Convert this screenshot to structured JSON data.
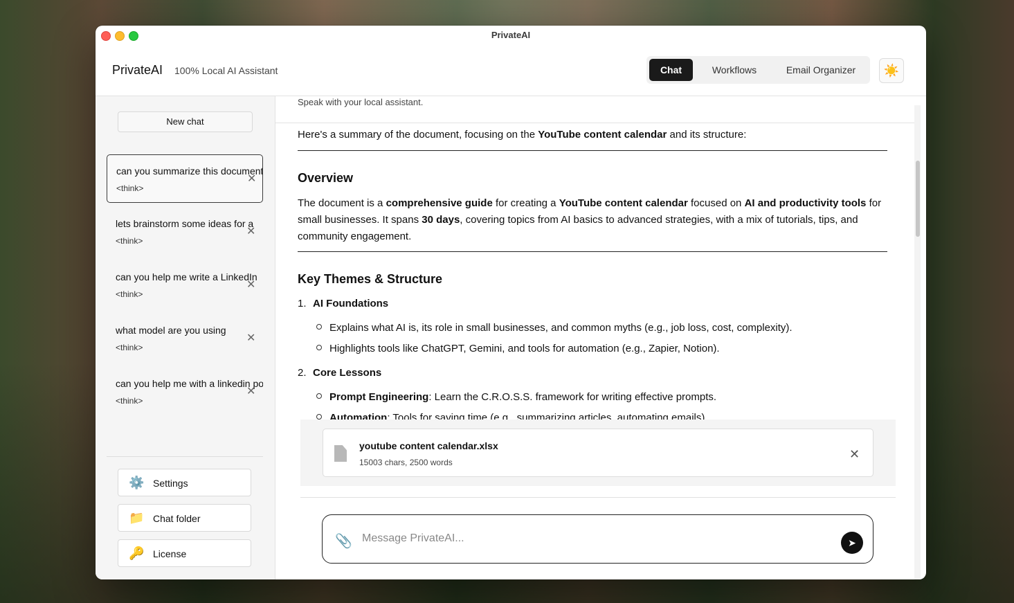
{
  "window": {
    "title": "PrivateAI"
  },
  "header": {
    "brand": "PrivateAI",
    "tagline": "100% Local AI Assistant",
    "tabs": [
      {
        "label": "Chat",
        "active": true
      },
      {
        "label": "Workflows",
        "active": false
      },
      {
        "label": "Email Organizer",
        "active": false
      }
    ],
    "theme_icon": "☀️"
  },
  "sidebar": {
    "new_chat_label": "New chat",
    "chats": [
      {
        "title": "can you summarize this document",
        "preview": "<think>",
        "active": true
      },
      {
        "title": "lets brainstorm some ideas for a",
        "preview": "<think>",
        "active": false
      },
      {
        "title": "can you help me write a LinkedIn",
        "preview": "<think>",
        "active": false
      },
      {
        "title": "what model are you using",
        "preview": "<think>",
        "active": false
      },
      {
        "title": "can you help me with a linkedin post",
        "preview": "<think>",
        "active": false
      }
    ],
    "close_glyph": "✕",
    "buttons": [
      {
        "label": "Settings",
        "icon": "⚙️"
      },
      {
        "label": "Chat folder",
        "icon": "📁"
      },
      {
        "label": "License",
        "icon": "🔑"
      }
    ]
  },
  "main": {
    "subtitle": "Speak with your local assistant.",
    "message": {
      "intro_prefix": "Here's a summary of the document, focusing on the ",
      "intro_bold": "YouTube content calendar",
      "intro_suffix": " and its structure:",
      "overview_heading": "Overview",
      "overview": {
        "t1": "The document is a ",
        "b1": "comprehensive guide",
        "t2": " for creating a ",
        "b2": "YouTube content calendar",
        "t3": " focused on ",
        "b3": "AI and productivity tools",
        "t4": " for small businesses. It spans ",
        "b4": "30 days",
        "t5": ", covering topics from AI basics to advanced strategies, with a mix of tutorials, tips, and community engagement."
      },
      "themes_heading": "Key Themes & Structure",
      "sections": [
        {
          "num": "1.",
          "title": "AI Foundations",
          "bullets": [
            "Explains what AI is, its role in small businesses, and common myths (e.g., job loss, cost, complexity).",
            "Highlights tools like ChatGPT, Gemini, and tools for automation (e.g., Zapier, Notion)."
          ]
        },
        {
          "num": "2.",
          "title": "Core Lessons",
          "bullets": [
            {
              "bold": "Prompt Engineering",
              "text": ": Learn the C.R.O.S.S. framework for writing effective prompts."
            },
            {
              "bold": "Automation",
              "text": ": Tools for saving time (e.g., summarizing articles, automating emails)."
            }
          ]
        }
      ]
    },
    "attachment": {
      "file_name": "youtube content calendar.xlsx",
      "meta": "15003 chars, 2500 words",
      "remove_glyph": "✕"
    },
    "composer": {
      "placeholder": "Message PrivateAI...",
      "value": "",
      "attach_glyph": "📎",
      "send_glyph": "➤"
    }
  }
}
